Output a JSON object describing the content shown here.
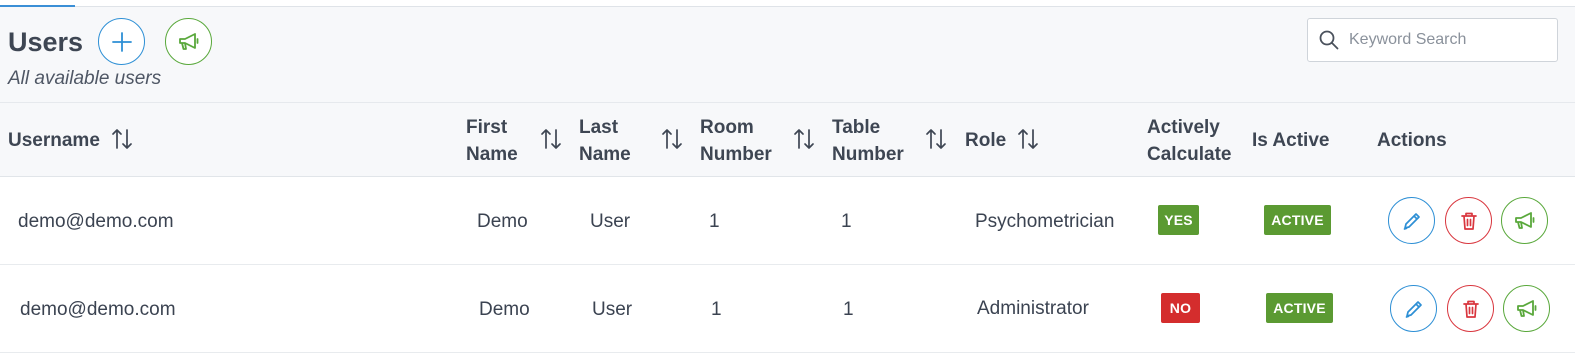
{
  "page": {
    "title": "Users",
    "subtitle": "All available users"
  },
  "search": {
    "placeholder": "Keyword Search",
    "value": ""
  },
  "table": {
    "columns": [
      {
        "key": "username",
        "line1": "Username",
        "line2": "",
        "sortable": true
      },
      {
        "key": "first_name",
        "line1": "First",
        "line2": "Name",
        "sortable": true
      },
      {
        "key": "last_name",
        "line1": "Last",
        "line2": "Name",
        "sortable": true
      },
      {
        "key": "room_number",
        "line1": "Room",
        "line2": "Number",
        "sortable": true
      },
      {
        "key": "table_number",
        "line1": "Table",
        "line2": "Number",
        "sortable": true
      },
      {
        "key": "role",
        "line1": "Role",
        "line2": "",
        "sortable": true
      },
      {
        "key": "actively_calculate",
        "line1": "Actively",
        "line2": "Calculate",
        "sortable": false
      },
      {
        "key": "is_active",
        "line1": "Is Active",
        "line2": "",
        "sortable": false
      },
      {
        "key": "actions",
        "line1": "Actions",
        "line2": "",
        "sortable": false
      }
    ],
    "rows": [
      {
        "username": "demo@demo.com",
        "first_name": "Demo",
        "last_name": "User",
        "room_number": "1",
        "table_number": "1",
        "role": "Psychometrician",
        "actively_calculate": "YES",
        "is_active": "ACTIVE"
      },
      {
        "username": "demo@demo.com",
        "first_name": "Demo",
        "last_name": "User",
        "room_number": "1",
        "table_number": "1",
        "role": "Administrator",
        "actively_calculate": "NO",
        "is_active": "ACTIVE"
      }
    ]
  },
  "icons": {
    "add": "plus-icon",
    "announce": "megaphone-icon",
    "search": "search-icon",
    "sort": "sort-arrows-icon",
    "edit": "pencil-icon",
    "delete": "trash-icon"
  },
  "colors": {
    "primary": "#2d8fd5",
    "danger": "#d9363e",
    "success": "#59a83b",
    "badge_green": "#5b9a32",
    "badge_red": "#d42d2d",
    "header_bg": "#f7f8fa"
  }
}
